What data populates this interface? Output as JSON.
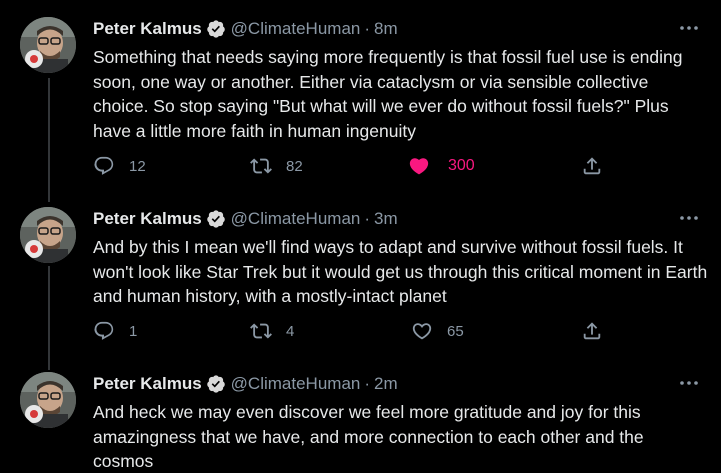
{
  "tweets": [
    {
      "author": "Peter Kalmus",
      "handle": "@ClimateHuman",
      "separator": "·",
      "time": "8m",
      "text": "Something that needs saying more frequently is that fossil fuel use is ending soon, one way or another. Either via cataclysm or via sensible collective choice. So stop saying \"But what will we ever do without fossil fuels?\" Plus have a little more faith in human ingenuity",
      "replies": "12",
      "retweets": "82",
      "likes": "300",
      "liked": true
    },
    {
      "author": "Peter Kalmus",
      "handle": "@ClimateHuman",
      "separator": "·",
      "time": "3m",
      "text": "And by this I mean we'll find ways to adapt and survive without fossil fuels. It won't look like Star Trek but it would get us through this critical moment in Earth and human history, with a mostly-intact planet",
      "replies": "1",
      "retweets": "4",
      "likes": "65",
      "liked": false
    },
    {
      "author": "Peter Kalmus",
      "handle": "@ClimateHuman",
      "separator": "·",
      "time": "2m",
      "text": "And heck we may even discover we feel more gratitude and joy for this amazingness that we have, and more connection to each other and the cosmos"
    }
  ],
  "colors": {
    "background": "#000000",
    "text": "#e7e9ea",
    "secondary": "#8b98a5",
    "like": "#f91880",
    "verified": "#d9d9d9",
    "thread_line": "#333639"
  },
  "icons": [
    "reply-icon",
    "retweet-icon",
    "like-icon",
    "share-icon",
    "verified-badge-icon",
    "more-icon"
  ]
}
